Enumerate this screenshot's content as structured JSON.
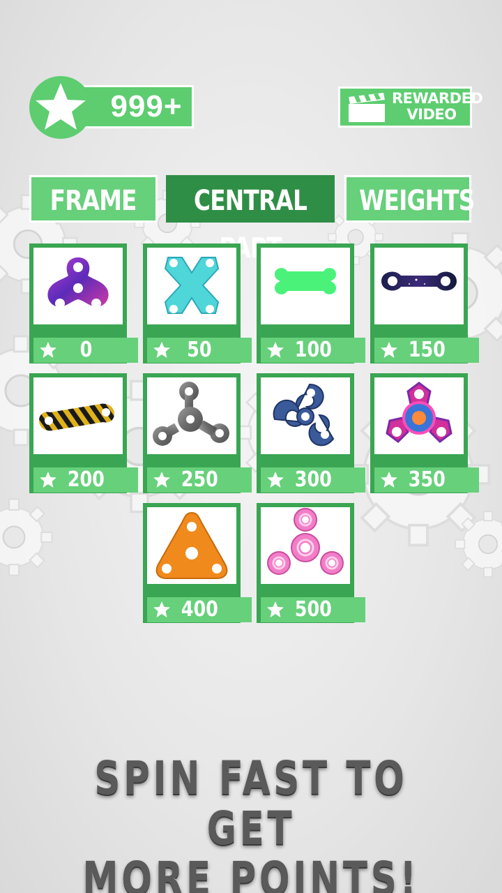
{
  "header": {
    "score": "999+",
    "rewarded_video_line1": "REWARDED",
    "rewarded_video_line2": "VIDEO"
  },
  "tabs": [
    {
      "label": "FRAME",
      "active": false
    },
    {
      "label": "CENTRAL PART",
      "active": true
    },
    {
      "label": "WEIGHTS",
      "active": false
    }
  ],
  "items": [
    {
      "price": "0",
      "icon": "purple-galaxy-tri-spinner-icon"
    },
    {
      "price": "50",
      "icon": "cyan-x-spinner-icon"
    },
    {
      "price": "100",
      "icon": "green-bone-spinner-icon"
    },
    {
      "price": "150",
      "icon": "space-bar-spinner-icon"
    },
    {
      "price": "200",
      "icon": "hazard-stripe-bar-spinner-icon"
    },
    {
      "price": "250",
      "icon": "metal-tri-spinner-icon"
    },
    {
      "price": "300",
      "icon": "blue-swirl-spinner-icon"
    },
    {
      "price": "350",
      "icon": "neon-pink-spinner-icon"
    },
    {
      "price": "400",
      "icon": "orange-triangle-spinner-icon"
    },
    {
      "price": "500",
      "icon": "pink-ring-spinner-icon"
    }
  ],
  "footer": {
    "line1": "SPIN FAST TO GET",
    "line2": "MORE POINTS!"
  },
  "colors": {
    "green_light": "#66d07a",
    "green_dark": "#2f8e45",
    "card_green": "#3aa552"
  }
}
